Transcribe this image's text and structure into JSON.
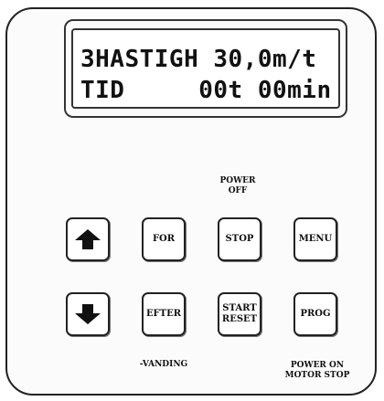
{
  "display": {
    "line1": "3HASTIGH 30,0m/t",
    "line2": "TID     00t 00min"
  },
  "keys": {
    "up": {
      "icon": "arrow-up-icon"
    },
    "down": {
      "icon": "arrow-down-icon"
    },
    "for": "FOR",
    "efter": "EFTER",
    "stop": "STOP",
    "start_reset": "START\nRESET",
    "menu": "MENU",
    "prog": "PROG"
  },
  "captions": {
    "power_off": "POWER\nOFF",
    "vanding": "-VANDING",
    "power_on_motor_stop": "POWER ON\nMOTOR STOP"
  }
}
